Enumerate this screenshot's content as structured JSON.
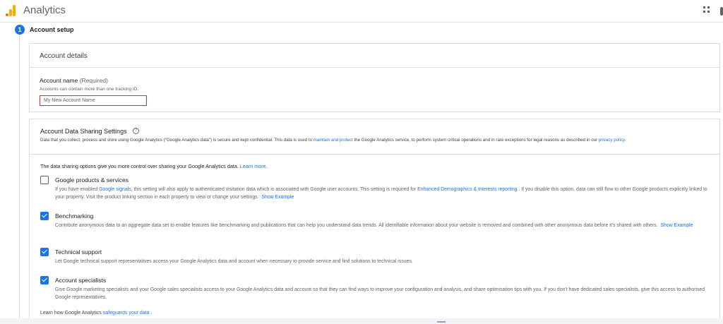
{
  "header": {
    "app_name": "Analytics"
  },
  "stepper": {
    "step_number": "1",
    "step_label": "Account setup"
  },
  "account_details": {
    "section_title": "Account details",
    "field_label": "Account name",
    "field_required": "(Required)",
    "field_hint": "Accounts can contain more than one tracking ID.",
    "field_placeholder": "My New Account Name",
    "field_value": ""
  },
  "sharing": {
    "section_title": "Account Data Sharing Settings",
    "desc_part1": "Data that you collect, process and store using Google Analytics (\"Google Analytics data\") is secure and kept confidential. This data is used to ",
    "desc_link": "maintain and protect",
    "desc_part2": " the Google Analytics service, to perform system critical operations and in rare exceptions for legal reasons as described in our ",
    "desc_link2": "privacy policy",
    "desc_part3": ".",
    "intro_text": "The data sharing options give you more control over sharing your Google Analytics data. ",
    "intro_link": "Learn more.",
    "options": [
      {
        "title": "Google products & services",
        "checked": false,
        "desc_part1": "If you have enabled ",
        "desc_link1": "Google signals",
        "desc_part2": ", this setting will also apply to authenticated visitation data which is associated with Google user accounts. This setting is required for ",
        "desc_link2": "Enhanced Demographics & Interests reporting",
        "desc_part3": " . If you disable this option, data can still flow to other Google products explicitly linked to your property. Visit the product linking section in each property to view or change your settings.",
        "show_example": "Show Example"
      },
      {
        "title": "Benchmarking",
        "checked": true,
        "desc": "Contribute anonymous data to an aggregate data set to enable features like benchmarking and publications that can help you understand data trends. All identifiable information about your website is removed and combined with other anonymous data before it's shared with others.",
        "show_example": "Show Example"
      },
      {
        "title": "Technical support",
        "checked": true,
        "desc": "Let Google technical support representatives access your Google Analytics data and account when necessary to provide service and find solutions to technical issues."
      },
      {
        "title": "Account specialists",
        "checked": true,
        "desc": "Give Google marketing specialists and your Google sales specialists access to your Google Analytics data and account so that they can find ways to improve your configuration and analysis, and share optimisation tips with you. If you don't have dedicated sales specialists, give this access to authorised Google representatives."
      }
    ],
    "footer_part1": "Learn how Google Analytics ",
    "footer_link": "safeguards your data",
    "footer_part2": " ."
  }
}
